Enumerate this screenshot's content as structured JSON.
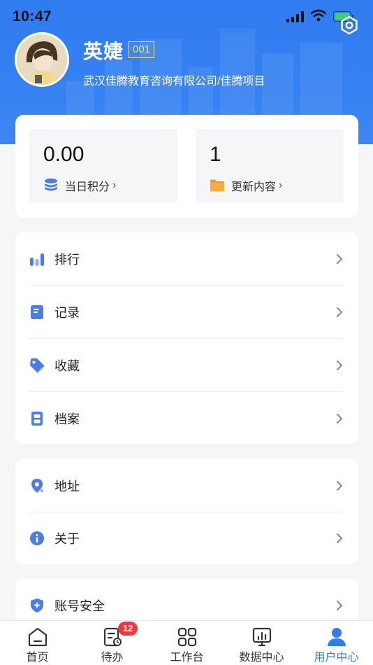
{
  "status_bar": {
    "time": "10:47"
  },
  "profile": {
    "name": "英婕",
    "code": "001",
    "organization": "武汉佳腾教育咨询有限公司/佳腾项目"
  },
  "stats": [
    {
      "value": "0.00",
      "label": "当日积分",
      "icon": "database-icon"
    },
    {
      "value": "1",
      "label": "更新内容",
      "icon": "folder-icon"
    }
  ],
  "menu_group_1": [
    {
      "label": "排行",
      "icon": "bar-chart-icon"
    },
    {
      "label": "记录",
      "icon": "document-icon"
    },
    {
      "label": "收藏",
      "icon": "tag-icon"
    },
    {
      "label": "档案",
      "icon": "archive-icon"
    }
  ],
  "menu_group_2": [
    {
      "label": "地址",
      "icon": "location-pin-icon"
    },
    {
      "label": "关于",
      "icon": "info-icon"
    }
  ],
  "menu_group_3": [
    {
      "label": "账号安全",
      "icon": "shield-icon"
    }
  ],
  "tabbar": {
    "items": [
      {
        "label": "首页",
        "icon": "home-icon"
      },
      {
        "label": "待办",
        "icon": "todo-icon",
        "badge": "12"
      },
      {
        "label": "工作台",
        "icon": "grid-icon"
      },
      {
        "label": "数据中心",
        "icon": "monitor-chart-icon"
      },
      {
        "label": "用户中心",
        "icon": "user-icon",
        "active": true
      }
    ]
  },
  "colors": {
    "primary": "#2f7bf0",
    "badge": "#f0383b",
    "code_badge": "#f6e07a",
    "folder": "#f59a23"
  }
}
